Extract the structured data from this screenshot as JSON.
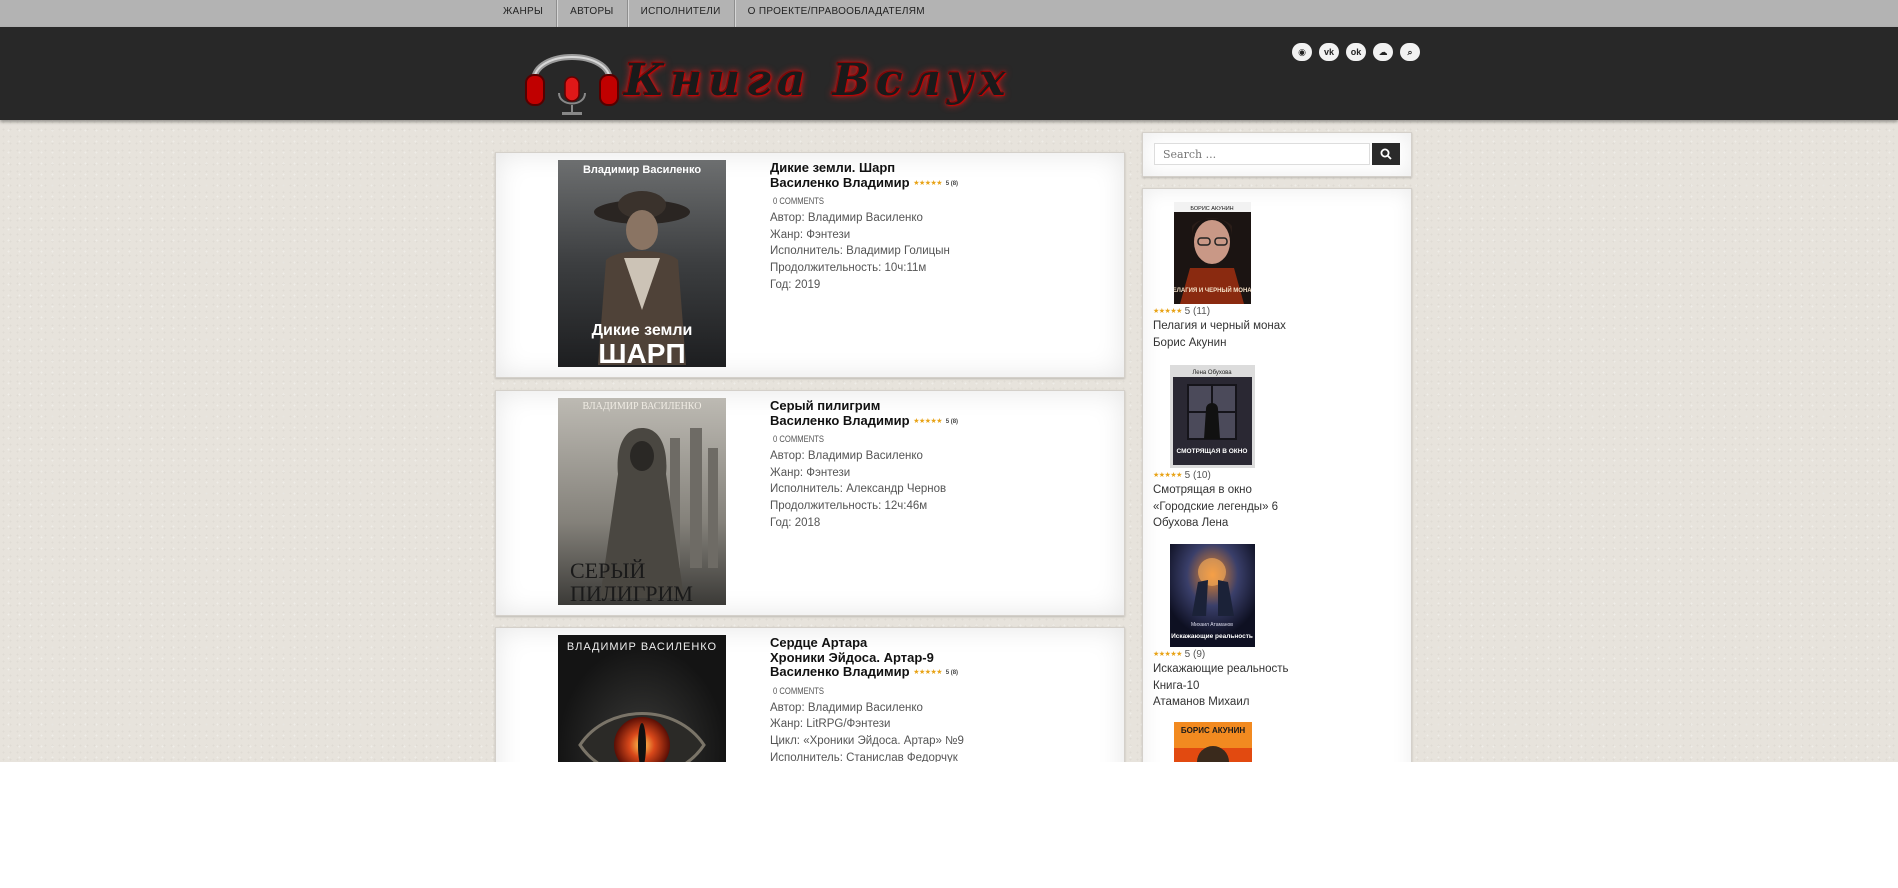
{
  "nav": {
    "items": [
      "ЖАНРЫ",
      "АВТОРЫ",
      "ИСПОЛНИТЕЛИ",
      "О ПРОЕКТЕ/ПРАВООБЛАДАТЕЛЯМ"
    ]
  },
  "header": {
    "logo_text": "Книга Вслух"
  },
  "social": [
    {
      "name": "eye-icon",
      "glyph": "◉"
    },
    {
      "name": "vk-icon",
      "glyph": "vk"
    },
    {
      "name": "odnoklassniki-icon",
      "glyph": "ok"
    },
    {
      "name": "cloud-icon",
      "glyph": "☁"
    },
    {
      "name": "search-icon",
      "glyph": "⌕"
    }
  ],
  "colors": {
    "accent": "#d01010",
    "header_bg": "#282828",
    "nav_bg": "#b3b3b3",
    "stars": "#e8a317"
  },
  "posts": [
    {
      "title_lines": [
        "Дикие земли. Шарп",
        "Василенко Владимир"
      ],
      "stars": "★★★★★",
      "rating_count": "5 (8)",
      "comments": "0 COMMENTS",
      "meta": [
        "Автор: Владимир Василенко",
        "Жанр: Фэнтези",
        "Исполнитель: Владимир Голицын",
        "Продолжительность: 10ч:11м",
        "Год: 2019"
      ],
      "cover": {
        "author": "Владимир Василенко",
        "title": [
          "Дикие земли",
          "ШАРП"
        ]
      }
    },
    {
      "title_lines": [
        "Серый пилигрим",
        "Василенко Владимир"
      ],
      "stars": "★★★★★",
      "rating_count": "5 (8)",
      "comments": "0 COMMENTS",
      "meta": [
        "Автор: Владимир Василенко",
        "Жанр: Фэнтези",
        "Исполнитель: Александр Чернов",
        "Продолжительность: 12ч:46м",
        "Год: 2018"
      ],
      "cover": {
        "author": "ВЛАДИМИР ВАСИЛЕНКО",
        "title": [
          "СЕРЫЙ",
          "ПИЛИГРИМ"
        ]
      }
    },
    {
      "title_lines": [
        "Сердце Артара",
        "Хроники Эйдоса. Артар-9",
        "Василенко Владимир"
      ],
      "stars": "★★★★★",
      "rating_count": "5 (8)",
      "comments": "0 COMMENTS",
      "meta": [
        "Автор: Владимир Василенко",
        "Жанр: LitRPG/Фэнтези",
        "Цикл: «Хроники Эйдоса. Артар» №9",
        "Исполнитель: Станислав Федорчук"
      ],
      "cover": {
        "author": "ВЛАДИМИР ВАСИЛЕНКО",
        "title": []
      }
    }
  ],
  "search": {
    "placeholder": "Search ..."
  },
  "sidebar_items": [
    {
      "stars": "★★★★★",
      "rating": "5 (11)",
      "lines": [
        "Пелагия и черный монах",
        "Борис Акунин"
      ],
      "cover": {
        "top": "БОРИС АКУНИН",
        "title": "ПЕЛАГИЯ И ЧЕРНЫЙ МОНАХ"
      }
    },
    {
      "stars": "★★★★★",
      "rating": "5 (10)",
      "lines": [
        "Смотрящая в окно",
        "«Городские легенды» 6",
        "Обухова Лена"
      ],
      "cover": {
        "top": "Лена Обухова",
        "title": "СМОТРЯЩАЯ В ОКНО"
      }
    },
    {
      "stars": "★★★★★",
      "rating": "5 (9)",
      "lines": [
        "Искажающие реальность",
        "Книга-10",
        "Атаманов Михаил"
      ],
      "cover": {
        "top": "Михаил Атаманов",
        "title": "Искажающие реальность"
      }
    },
    {
      "stars": "",
      "rating": "",
      "lines": [],
      "cover": {
        "top": "БОРИС АКУНИН",
        "title": ""
      }
    }
  ]
}
